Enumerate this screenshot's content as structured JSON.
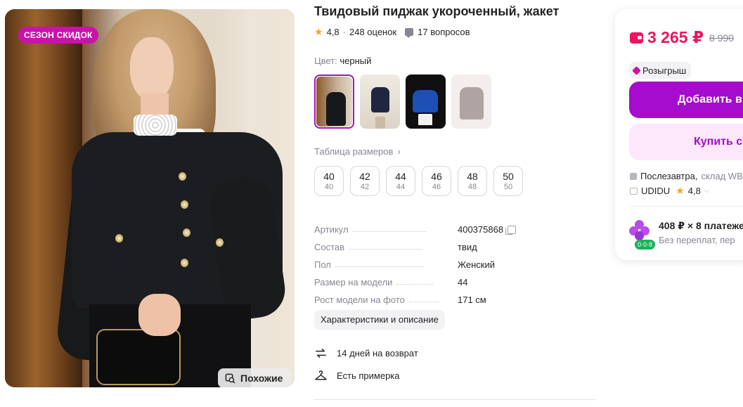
{
  "photo": {
    "badge": "СЕЗОН СКИДОК",
    "similar_label": "Похожие"
  },
  "product": {
    "title": "Твидовый пиджак укороченный, жакет",
    "rating": "4,8",
    "reviews": "248 оценок",
    "questions": "17 вопросов"
  },
  "color": {
    "label": "Цвет:",
    "value": "черный",
    "swatches": [
      {
        "selected": true
      },
      {
        "selected": false
      },
      {
        "selected": false
      },
      {
        "selected": false
      }
    ]
  },
  "sizes": {
    "table_link": "Таблица размеров",
    "items": [
      {
        "main": "40",
        "sub": "40"
      },
      {
        "main": "42",
        "sub": "42"
      },
      {
        "main": "44",
        "sub": "44"
      },
      {
        "main": "46",
        "sub": "46"
      },
      {
        "main": "48",
        "sub": "48"
      },
      {
        "main": "50",
        "sub": "50"
      }
    ]
  },
  "specs": [
    {
      "key": "Артикул",
      "value": "400375868",
      "copyable": true
    },
    {
      "key": "Состав",
      "value": "твид"
    },
    {
      "key": "Пол",
      "value": "Женский"
    },
    {
      "key": "Размер на модели",
      "value": "44"
    },
    {
      "key": "Рост модели на фото",
      "value": "171 см"
    }
  ],
  "description_button": "Характеристики и описание",
  "features": {
    "return": "14 дней на возврат",
    "fitting": "Есть примерка"
  },
  "buy": {
    "price": "3 265 ₽",
    "old_price": "8 990",
    "raffle": "Розыгрыш",
    "add_button": "Добавить в",
    "buy_button": "Купить с",
    "delivery_main": "Послезавтра,",
    "delivery_muted": "склад WB",
    "seller_name": "UDIDU",
    "seller_rating": "4,8",
    "installment_main": "408 ₽ × 8 платеже",
    "installment_sub": "Без переплат, пер",
    "installment_tag": "0·0·8"
  },
  "colors": {
    "accent": "#a50ccd",
    "price": "#f0135f",
    "badge": "#cb11ab",
    "muted": "#868695"
  }
}
